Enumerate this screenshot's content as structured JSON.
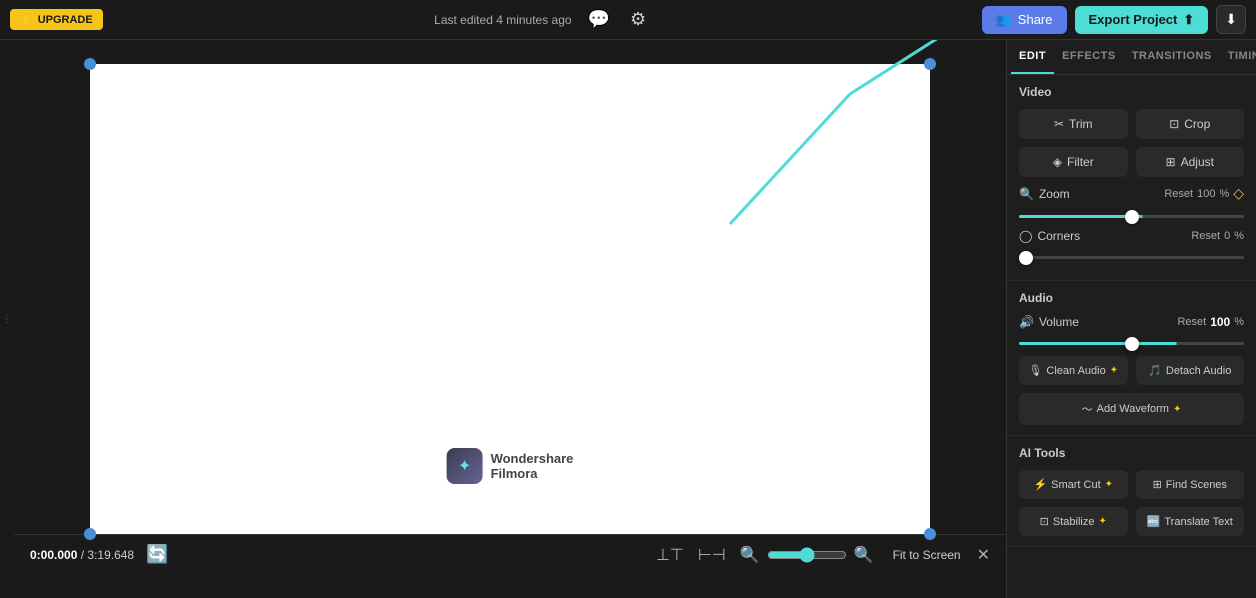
{
  "topbar": {
    "upgrade_label": "UPGRADE",
    "upgrade_star": "⚡",
    "last_edited": "Last edited 4 minutes ago",
    "share_label": "Share",
    "export_label": "Export Project",
    "export_icon": "⬆",
    "download_icon": "⬇"
  },
  "canvas": {
    "watermark_name": "Wondershare",
    "watermark_sub": "Filmora",
    "watermark_icon": "✦"
  },
  "bottom_bar": {
    "current_time": "0:00.000",
    "separator": "/",
    "total_time": "3:19.648",
    "fit_label": "Fit to Screen"
  },
  "right_panel": {
    "tabs": [
      "EDIT",
      "EFFECTS",
      "TRANSITIONS",
      "TIMING"
    ],
    "active_tab": "EDIT",
    "video_section": "Video",
    "trim_label": "Trim",
    "crop_label": "Crop",
    "filter_label": "Filter",
    "adjust_label": "Adjust",
    "zoom_label": "Zoom",
    "zoom_reset": "Reset",
    "zoom_value": "100",
    "zoom_unit": "%",
    "zoom_percent": 55,
    "corners_label": "Corners",
    "corners_reset": "Reset",
    "corners_value": "0",
    "corners_unit": "%",
    "corners_percent": 0,
    "audio_section": "Audio",
    "volume_label": "Volume",
    "volume_reset": "Reset",
    "volume_value": "100",
    "volume_unit": "%",
    "volume_percent": 70,
    "clean_audio_label": "Clean Audio",
    "detach_audio_label": "Detach Audio",
    "add_waveform_label": "Add Waveform",
    "ai_tools_section": "AI Tools",
    "smart_cut_label": "Smart Cut",
    "find_scenes_label": "Find Scenes",
    "stabilize_label": "Stabilize",
    "translate_label": "Translate Text"
  }
}
